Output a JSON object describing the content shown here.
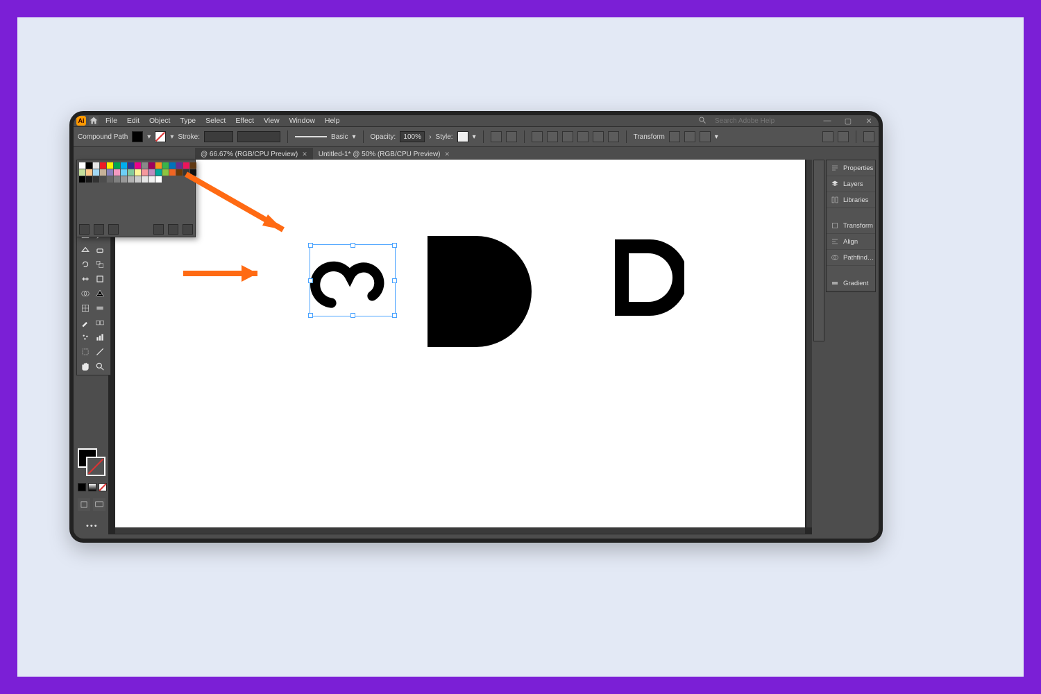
{
  "app": {
    "name": "Ai"
  },
  "menu": [
    "File",
    "Edit",
    "Object",
    "Type",
    "Select",
    "Effect",
    "View",
    "Window",
    "Help"
  ],
  "search": {
    "placeholder": "Search Adobe Help"
  },
  "options_bar": {
    "label_left": "Compound Path",
    "stroke_label": "Stroke:",
    "profile_label": "Basic",
    "opacity_label": "Opacity:",
    "opacity_value": "100%",
    "style_label": "Style:",
    "transform_label": "Transform"
  },
  "tabs": [
    {
      "title": "@ 66.67% (RGB/CPU Preview)",
      "active": false
    },
    {
      "title": "Untitled-1* @ 50% (RGB/CPU Preview)",
      "active": true
    }
  ],
  "right_panels": [
    "Properties",
    "Layers",
    "Libraries",
    "Transform",
    "Align",
    "Pathfind…",
    "Gradient"
  ],
  "swatch_colors": [
    "#ffffff",
    "#000000",
    "#e6e6e6",
    "#ed1c24",
    "#fff200",
    "#00a651",
    "#00aeef",
    "#2e3192",
    "#ec008c",
    "#898989",
    "#9e005d",
    "#f7941e",
    "#39b54a",
    "#0072bc",
    "#662d91",
    "#ed145b",
    "#603913",
    "#c4df9b",
    "#fdc689",
    "#a3d9f5",
    "#c7b299",
    "#8781bd",
    "#f49ac1",
    "#6dcff6",
    "#82ca9c",
    "#fff799",
    "#f5989d",
    "#bd8cbf",
    "#00a99d",
    "#8cc63f",
    "#f26522",
    "#6a3906",
    "#363636",
    "#111111",
    "#000000",
    "#1a1a1a",
    "#333333",
    "#4d4d4d",
    "#666666",
    "#808080",
    "#999999",
    "#b3b3b3",
    "#cccccc",
    "#e6e6e6",
    "#f2f2f2",
    "#ffffff"
  ]
}
